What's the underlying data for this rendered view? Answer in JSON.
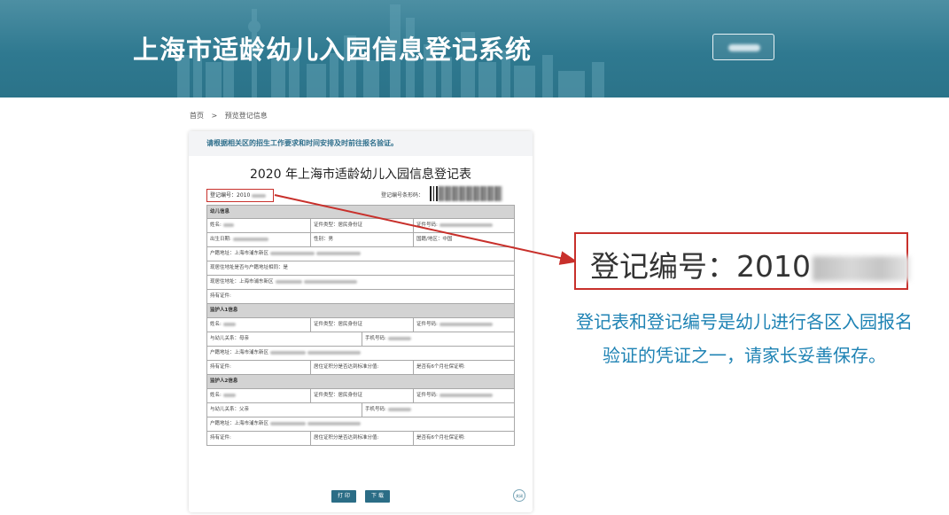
{
  "header": {
    "site_title": "上海市适龄幼儿入园信息登记系统",
    "button_label": ""
  },
  "breadcrumb": {
    "home": "首页",
    "separator": ">",
    "current": "预览登记信息"
  },
  "card": {
    "notice": "请根据相关区的招生工作要求和时间安排及时前往报名验证。",
    "form_title": "2020 年上海市适龄幼儿入园信息登记表",
    "reg_no_label": "登记编号：2010",
    "barcode_label": "登记编号条形码：",
    "child_section": "幼儿信息",
    "child": {
      "name": "姓名:",
      "id_type": "证件类型：居民身份证",
      "id_no": "证件号码:",
      "birth": "出生日期:",
      "gender": "性别：男",
      "nation": "国籍/地区：中国",
      "hukou": "户籍地址：上海市浦东新区",
      "same_addr": "现居住地址是否与户籍地址相同：是",
      "live_addr": "现居住地址：上海市浦东新区",
      "cert": "持有证件:"
    },
    "guardian1_section": "监护人1信息",
    "guardian1": {
      "name": "姓名:",
      "id_type": "证件类型：居民身份证",
      "id_no": "证件号码:",
      "relation": "与幼儿关系：母亲",
      "phone": "手机号码:",
      "hukou": "户籍地址：上海市浦东新区",
      "cert": "持有证件:",
      "score": "居住证积分是否达到标准分值:",
      "insurance": "是否有6个月社保证明:"
    },
    "guardian2_section": "监护人2信息",
    "guardian2": {
      "name": "姓名:",
      "id_type": "证件类型：居民身份证",
      "id_no": "证件号码:",
      "relation": "与幼儿关系：父亲",
      "phone": "手机号码:",
      "hukou": "户籍地址：上海市浦东新区",
      "cert": "持有证件:",
      "score": "居住证积分是否达到标准分值:",
      "insurance": "是否有6个月社保证明:"
    },
    "print_button": "打 印",
    "download_button": "下 载",
    "close_label": "关闭"
  },
  "callout": {
    "reg_no_large": "登记编号：2010"
  },
  "caption": {
    "line1": "登记表和登记编号是幼儿进行各区入园报名",
    "line2": "验证的凭证之一，请家长妥善保存。"
  },
  "colors": {
    "banner": "#2f7990",
    "accent_red": "#c8302b",
    "caption_blue": "#1f83b4",
    "button": "#2b6d86"
  }
}
